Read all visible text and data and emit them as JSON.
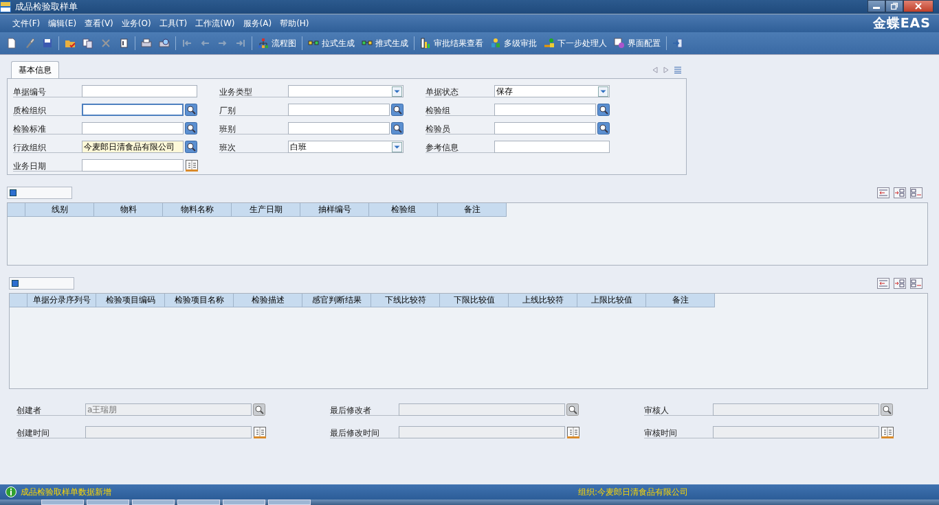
{
  "window": {
    "title": "成品检验取样单"
  },
  "brand": "金蝶EAS",
  "menu": [
    "文件(F)",
    "编辑(E)",
    "查看(V)",
    "业务(O)",
    "工具(T)",
    "工作流(W)",
    "服务(A)",
    "帮助(H)"
  ],
  "toolbar": [
    {
      "kind": "icon"
    },
    {
      "kind": "icon"
    },
    {
      "kind": "icon"
    },
    {
      "kind": "separator"
    },
    {
      "kind": "icon"
    },
    {
      "kind": "icon"
    },
    {
      "kind": "icon"
    },
    {
      "kind": "icon"
    },
    {
      "kind": "separator"
    },
    {
      "kind": "icon"
    },
    {
      "kind": "icon"
    },
    {
      "kind": "separator"
    },
    {
      "kind": "icon",
      "disabled": true
    },
    {
      "kind": "icon",
      "disabled": true
    },
    {
      "kind": "icon",
      "disabled": true
    },
    {
      "kind": "icon",
      "disabled": true
    },
    {
      "kind": "separator"
    },
    {
      "kind": "labeled",
      "label": "流程图"
    },
    {
      "kind": "separator"
    },
    {
      "kind": "labeled",
      "label": "拉式生成"
    },
    {
      "kind": "labeled",
      "label": "推式生成"
    },
    {
      "kind": "separator"
    },
    {
      "kind": "labeled",
      "label": "审批结果查看"
    },
    {
      "kind": "labeled",
      "label": "多级审批"
    },
    {
      "kind": "labeled",
      "label": "下一步处理人"
    },
    {
      "kind": "labeled",
      "label": "界面配置"
    },
    {
      "kind": "separator"
    },
    {
      "kind": "icon"
    }
  ],
  "tabs": [
    {
      "label": "基本信息",
      "selected": true
    }
  ],
  "fields": [
    {
      "label": "单据编号",
      "kind": "text",
      "focused": false,
      "highlighted": false
    },
    {
      "label": "业务类型",
      "kind": "combo",
      "focused": false,
      "highlighted": false
    },
    {
      "label": "单据状态",
      "kind": "combo",
      "value": "保存",
      "focused": false,
      "highlighted": false
    },
    {
      "label": "质检组织",
      "kind": "lookup",
      "focused": true,
      "highlighted": false
    },
    {
      "label": "厂别",
      "kind": "lookup",
      "focused": false,
      "highlighted": false
    },
    {
      "label": "检验组",
      "kind": "lookup",
      "focused": false,
      "highlighted": false
    },
    {
      "label": "检验标准",
      "kind": "lookup",
      "focused": false,
      "highlighted": false
    },
    {
      "label": "班别",
      "kind": "lookup",
      "focused": false,
      "highlighted": false
    },
    {
      "label": "检验员",
      "kind": "lookup",
      "focused": false,
      "highlighted": false
    },
    {
      "label": "行政组织",
      "kind": "lookup",
      "value": "今麦郎日清食品有限公司",
      "focused": false,
      "highlighted": true
    },
    {
      "label": "班次",
      "kind": "combo",
      "value": "白班",
      "focused": false,
      "highlighted": false
    },
    {
      "label": "参考信息",
      "kind": "text",
      "focused": false,
      "highlighted": false
    },
    {
      "label": "业务日期",
      "kind": "date",
      "focused": false,
      "highlighted": false
    }
  ],
  "grids": [
    {
      "columns": [
        "线别",
        "物料",
        "物料名称",
        "生产日期",
        "抽样编号",
        "检验组",
        "备注"
      ]
    },
    {
      "columns": [
        "单据分录序列号",
        "检验项目编码",
        "检验项目名称",
        "检验描述",
        "感官判断结果",
        "下线比较符",
        "下限比较值",
        "上线比较符",
        "上限比较值",
        "备注"
      ]
    }
  ],
  "audit": [
    {
      "label": "创建者",
      "kind": "lookup",
      "value": "a王瑞朋",
      "disabled": true
    },
    {
      "label": "最后修改者",
      "kind": "lookup",
      "disabled": true
    },
    {
      "label": "审核人",
      "kind": "lookup",
      "disabled": true
    },
    {
      "label": "创建时间",
      "kind": "date",
      "disabled": true
    },
    {
      "label": "最后修改时间",
      "kind": "date",
      "disabled": true
    },
    {
      "label": "审核时间",
      "kind": "date",
      "disabled": true
    }
  ],
  "status_bar": {
    "message": "成品检验取样单数据新增",
    "organization": "组织:今麦郎日清食品有限公司"
  }
}
